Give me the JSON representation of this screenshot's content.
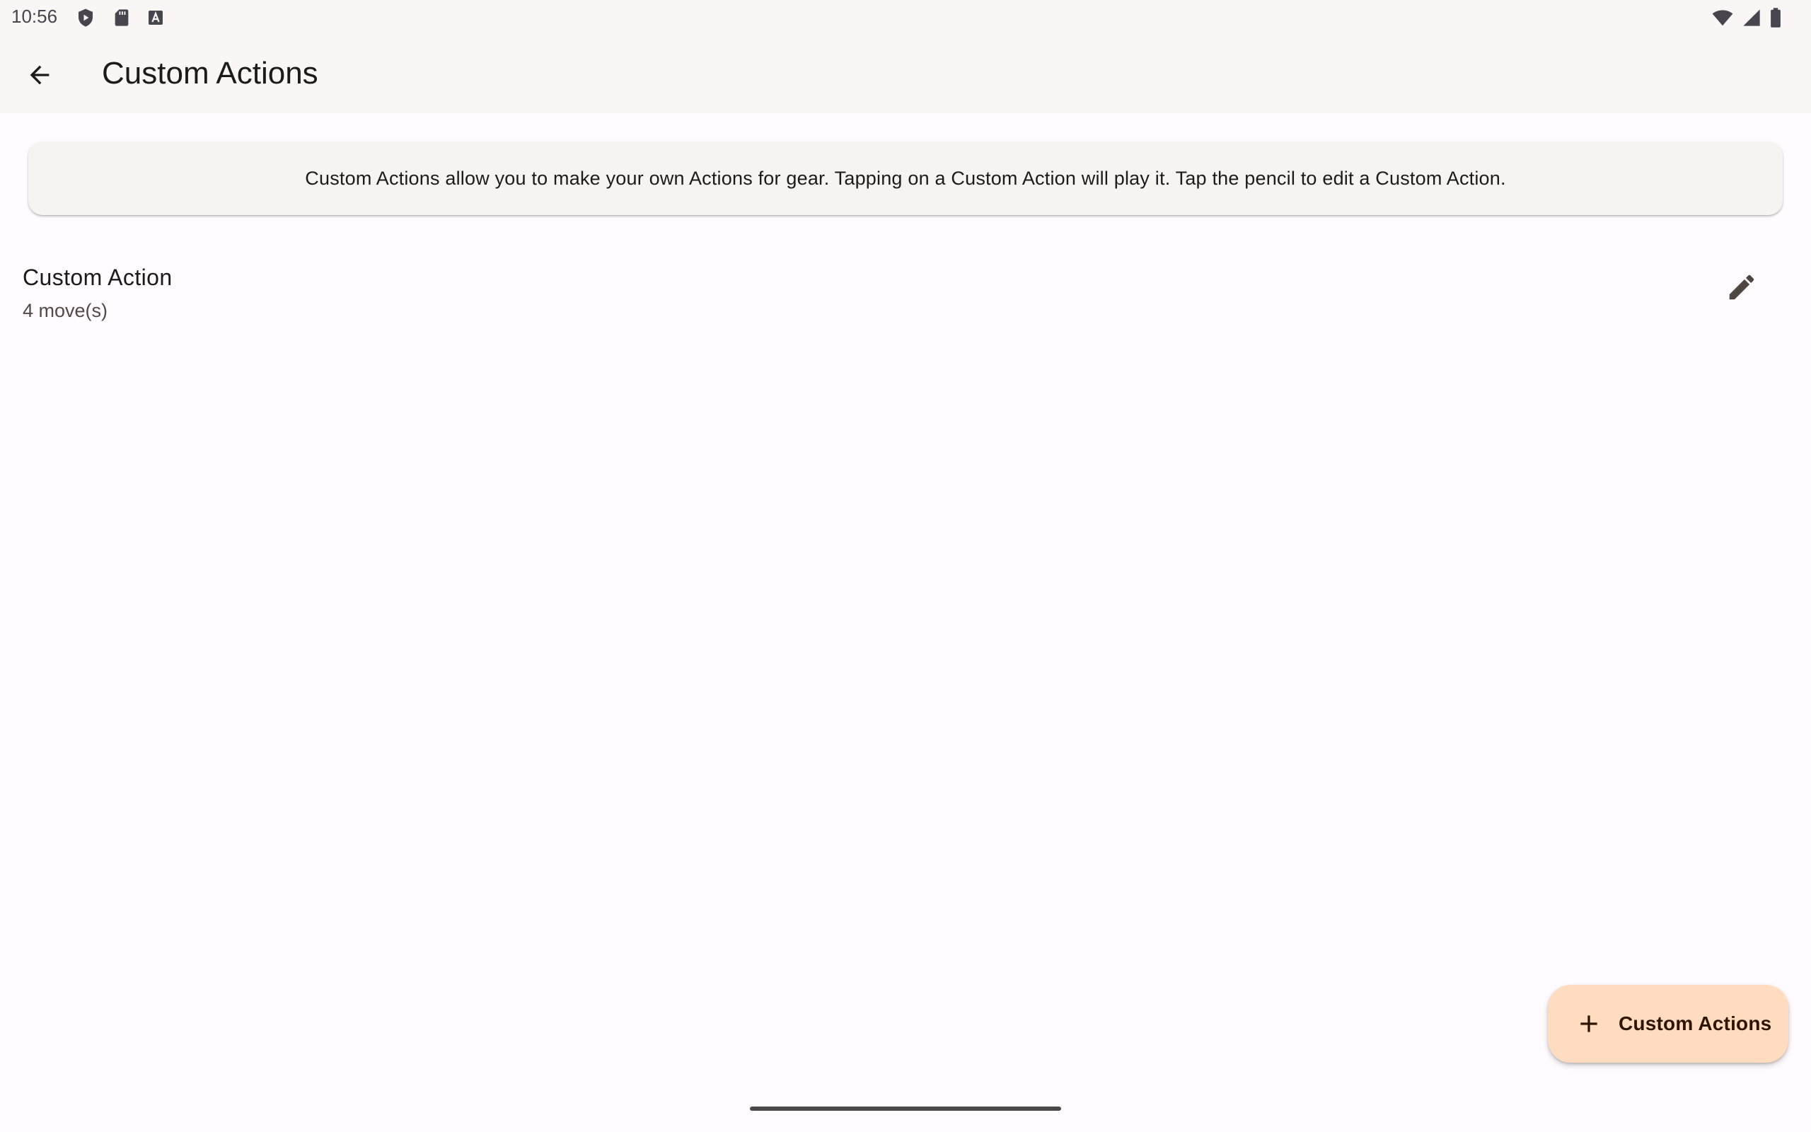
{
  "status_bar": {
    "time": "10:56",
    "left_icons": [
      "play-protect-icon",
      "sd-card-icon",
      "font-a-icon"
    ],
    "right_icons": [
      "wifi-icon",
      "cell-signal-icon",
      "battery-icon"
    ]
  },
  "app_bar": {
    "back_icon": "arrow-back-icon",
    "title": "Custom Actions"
  },
  "info_card": {
    "text": "Custom Actions allow you to make your own Actions for gear. Tapping on a Custom Action will play it. Tap the pencil to edit a Custom Action."
  },
  "list": {
    "items": [
      {
        "title": "Custom Action",
        "subtitle": "4 move(s)",
        "edit_icon": "pencil-icon"
      }
    ]
  },
  "fab": {
    "icon": "plus-icon",
    "label": "Custom Actions"
  },
  "colors": {
    "background": "#fffbfe",
    "app_bar": "#f9f6f5",
    "card": "#f6f3f1",
    "fab": "#ffdcc0",
    "fab_text": "#2d1600",
    "edit_icon": "#4d4540"
  }
}
